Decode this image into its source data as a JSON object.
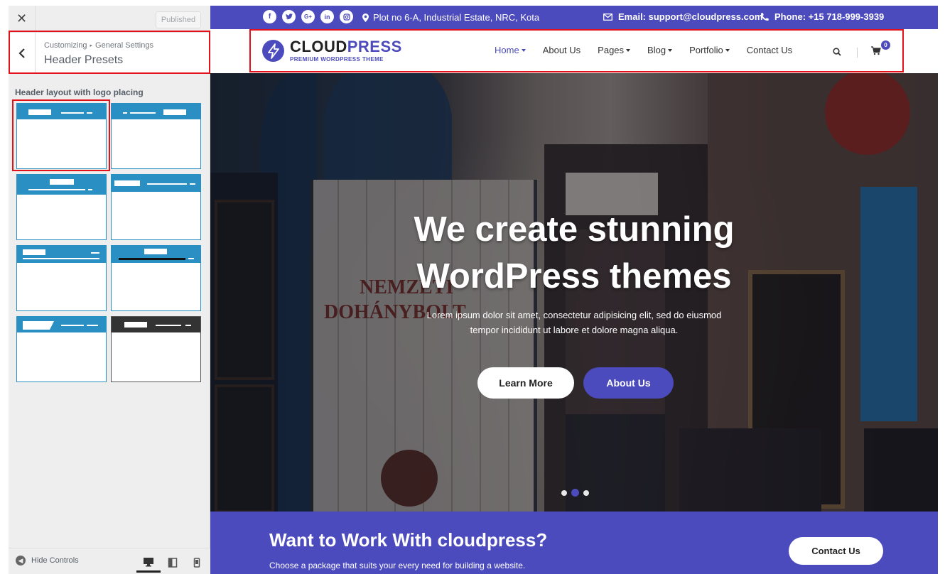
{
  "customizer": {
    "close_glyph": "✕",
    "published_label": "Published",
    "breadcrumb_parent": "Customizing",
    "breadcrumb_sep": "▸",
    "breadcrumb_current": "General Settings",
    "section_title": "Header Presets",
    "back_glyph": "‹",
    "presets_label": "Header layout with logo placing",
    "presets": [
      {
        "name": "logo-left-menu-right",
        "selected": true
      },
      {
        "name": "menu-left-logo-right",
        "selected": false
      },
      {
        "name": "logo-center",
        "selected": false
      },
      {
        "name": "logo-left-wide-menu",
        "selected": false
      },
      {
        "name": "logo-top-menu-below",
        "selected": false
      },
      {
        "name": "logo-center-menu-below",
        "selected": false
      },
      {
        "name": "logo-angled",
        "selected": false
      },
      {
        "name": "dark-header",
        "selected": false
      }
    ],
    "hide_controls_label": "Hide Controls",
    "devices": [
      "desktop",
      "tablet",
      "mobile"
    ],
    "active_device": "desktop",
    "highlight_color": "#e3111a"
  },
  "topbar": {
    "socials": [
      "facebook-icon",
      "twitter-icon",
      "google-plus-icon",
      "linkedin-icon",
      "instagram-icon"
    ],
    "social_glyphs": [
      "f",
      "t",
      "G+",
      "in",
      "◎"
    ],
    "address": "Plot no 6-A, Industrial Estate, NRC, Kota",
    "email": "Email: support@cloudpress.com",
    "phone": "Phone: +15 718-999-3939"
  },
  "header": {
    "logo_part1": "CLOUD",
    "logo_part2": "PRESS",
    "logo_tagline": "PREMIUM WORDPRESS THEME",
    "nav": [
      {
        "label": "Home",
        "dropdown": true,
        "active": true
      },
      {
        "label": "About Us",
        "dropdown": false,
        "active": false
      },
      {
        "label": "Pages",
        "dropdown": true,
        "active": false
      },
      {
        "label": "Blog",
        "dropdown": true,
        "active": false
      },
      {
        "label": "Portfolio",
        "dropdown": true,
        "active": false
      },
      {
        "label": "Contact Us",
        "dropdown": false,
        "active": false
      }
    ],
    "cart_count": "0"
  },
  "hero": {
    "title_line1": "We create stunning",
    "title_line2": "WordPress themes",
    "subtitle_line1": "Lorem ipsum dolor sit amet, consectetur adipisicing elit, sed do eiusmod",
    "subtitle_line2": "tempor incididunt ut labore et dolore magna aliqua.",
    "btn_primary": "Learn More",
    "btn_secondary": "About Us",
    "slides": 3,
    "active_slide": 2
  },
  "cta": {
    "title": "Want to Work With cloudpress?",
    "subtitle": "Choose a package that suits your every need for building a website.",
    "button": "Contact Us"
  },
  "colors": {
    "brand": "#4c4bbd",
    "preset_blue": "#2a8fc3",
    "sidebar_bg": "#eeeeee"
  }
}
